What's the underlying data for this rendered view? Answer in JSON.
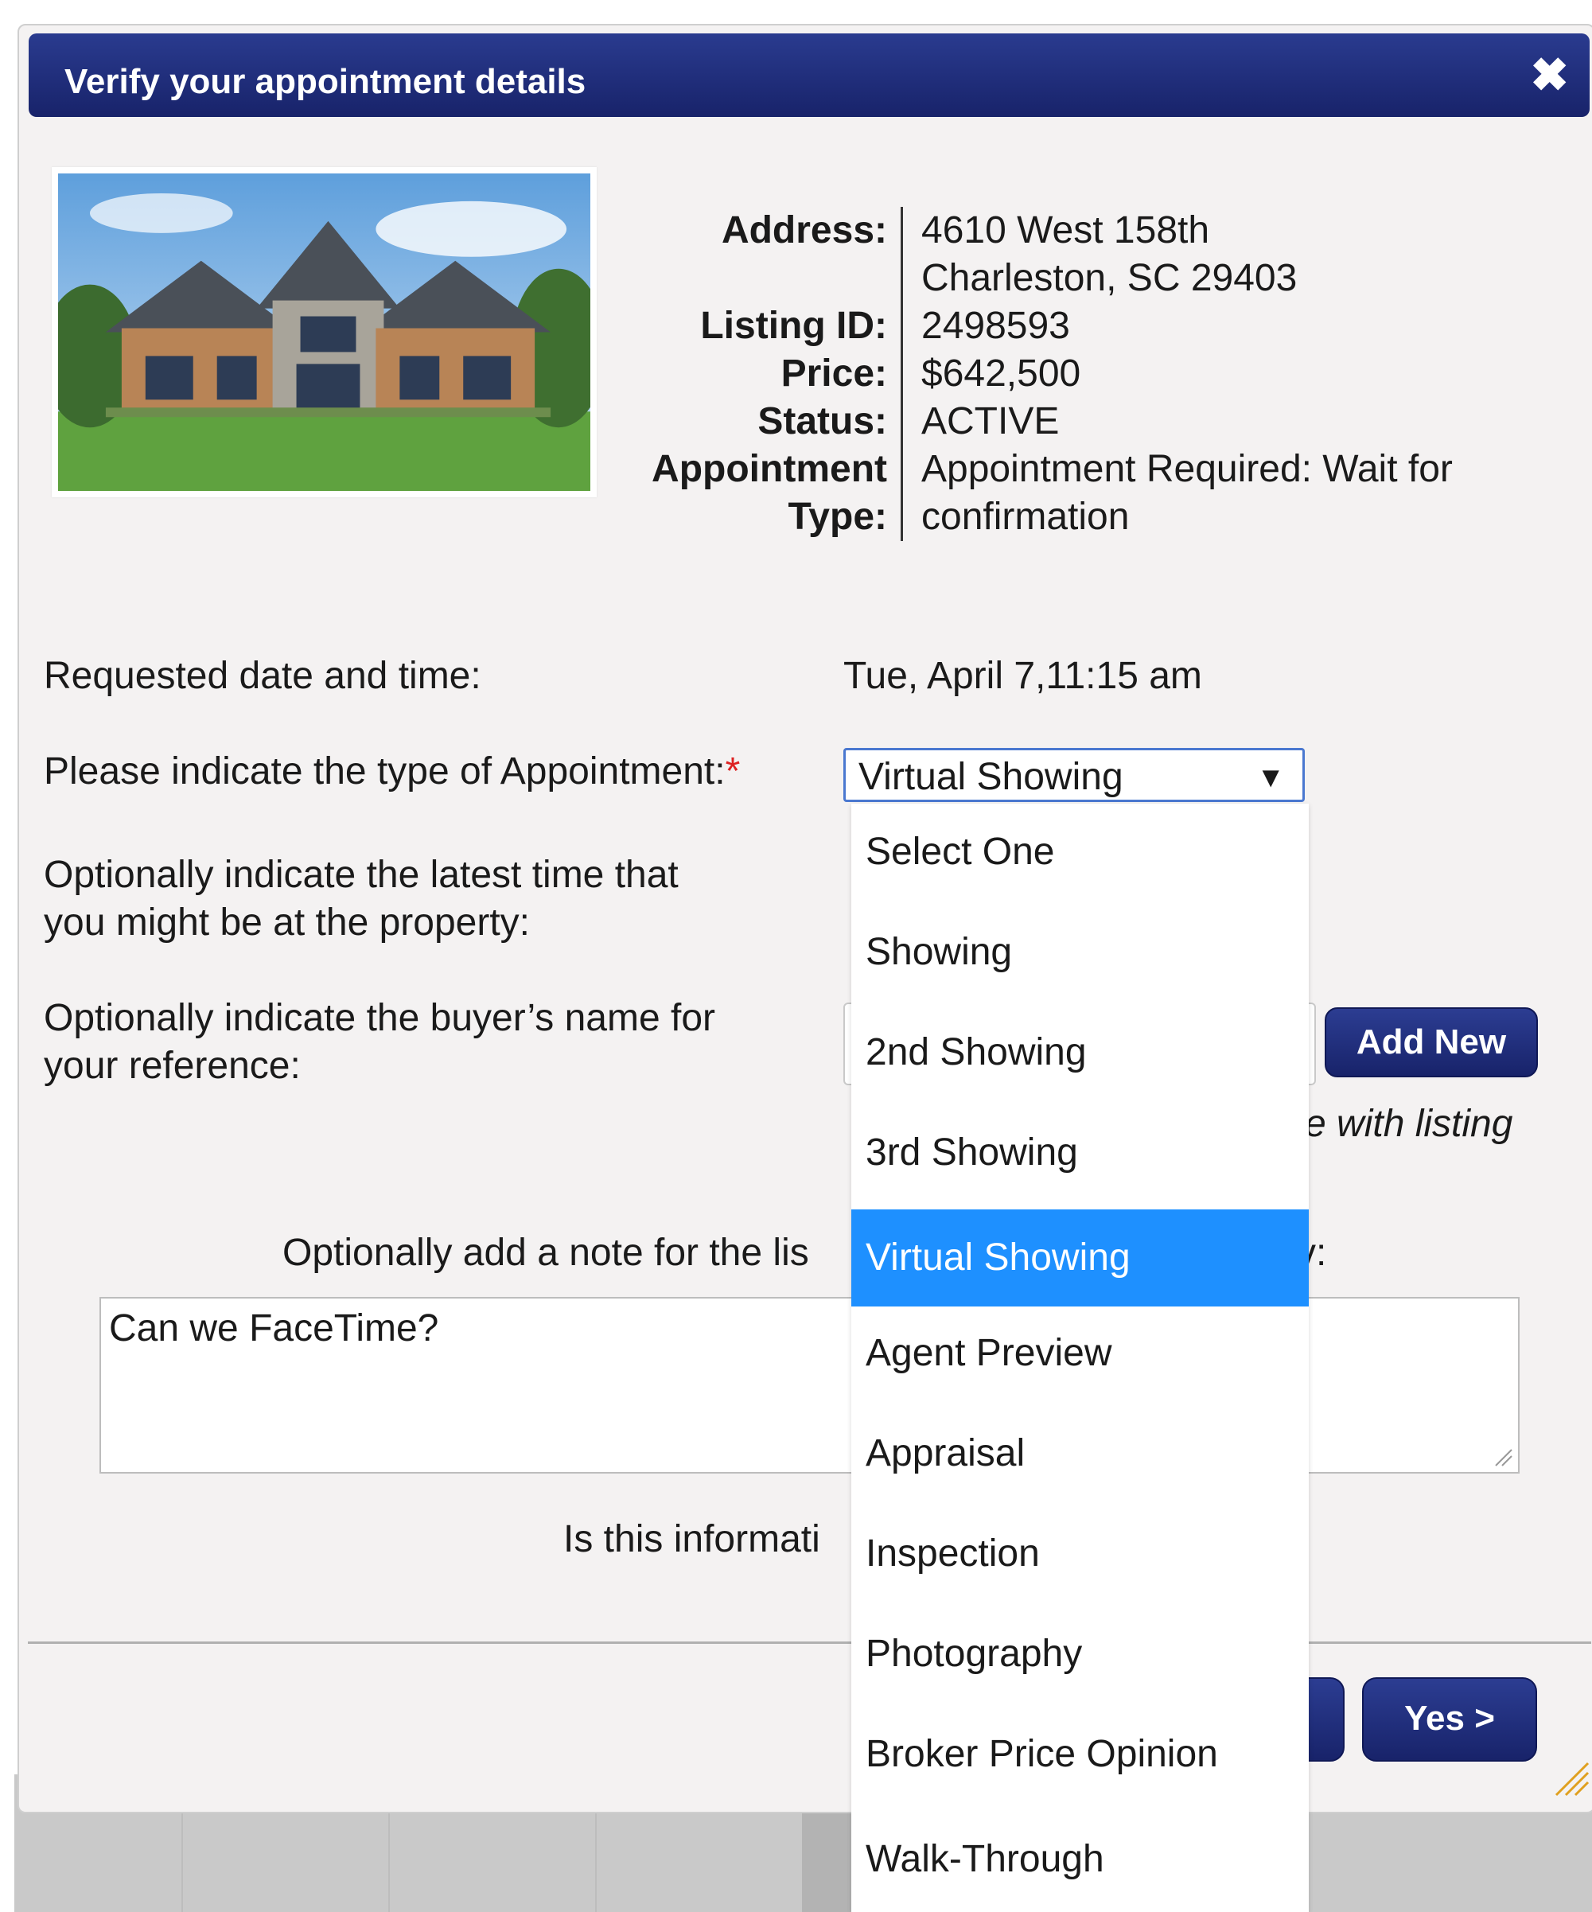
{
  "dialog": {
    "title": "Verify your appointment details",
    "close_symbol": "✖"
  },
  "listing": {
    "photo_icon": "house-photo",
    "labels": {
      "address": "Address:",
      "listing_id": "Listing ID:",
      "price": "Price:",
      "status": "Status:",
      "appointment_type_line1": "Appointment",
      "appointment_type_line2": "Type:"
    },
    "values": {
      "address_line1": "4610 West 158th",
      "address_line2": "Charleston, SC 29403",
      "listing_id": "2498593",
      "price": "$642,500",
      "status": "ACTIVE",
      "appointment_type_line1": "Appointment Required: Wait for",
      "appointment_type_line2": "confirmation"
    }
  },
  "form": {
    "requested_label": "Requested date and time:",
    "requested_value": "Tue, April 7,11:15 am",
    "type_label": "Please indicate the type of Appointment:",
    "type_required_marker": "*",
    "type_selected": "Virtual Showing",
    "type_arrow": "▼",
    "latest_time_label_line1": "Optionally indicate the latest time that",
    "latest_time_label_line2": "you might be at the property:",
    "buyer_label_line1": "Optionally indicate the buyer’s name for",
    "buyer_label_line2": "your reference:",
    "add_new_button": "Add New",
    "share_note_fragment": "e with listing",
    "note_label_start": "Optionally add a note for the lis",
    "note_label_end": "v:",
    "note_value": "Can we FaceTime?",
    "confirm_question": "Is this informati"
  },
  "dropdown": {
    "options": [
      "Select One",
      "Showing",
      "2nd Showing",
      "3rd Showing",
      "Virtual Showing",
      "Agent Preview",
      "Appraisal",
      "Inspection",
      "Photography",
      "Broker Price Opinion",
      "Walk-Through"
    ],
    "selected": "Virtual Showing"
  },
  "footer": {
    "yes_button": "Yes >"
  },
  "colors": {
    "titlebar": "#1f2d7a",
    "dropdown_highlight": "#1e90ff",
    "select_border": "#4a78d0"
  }
}
